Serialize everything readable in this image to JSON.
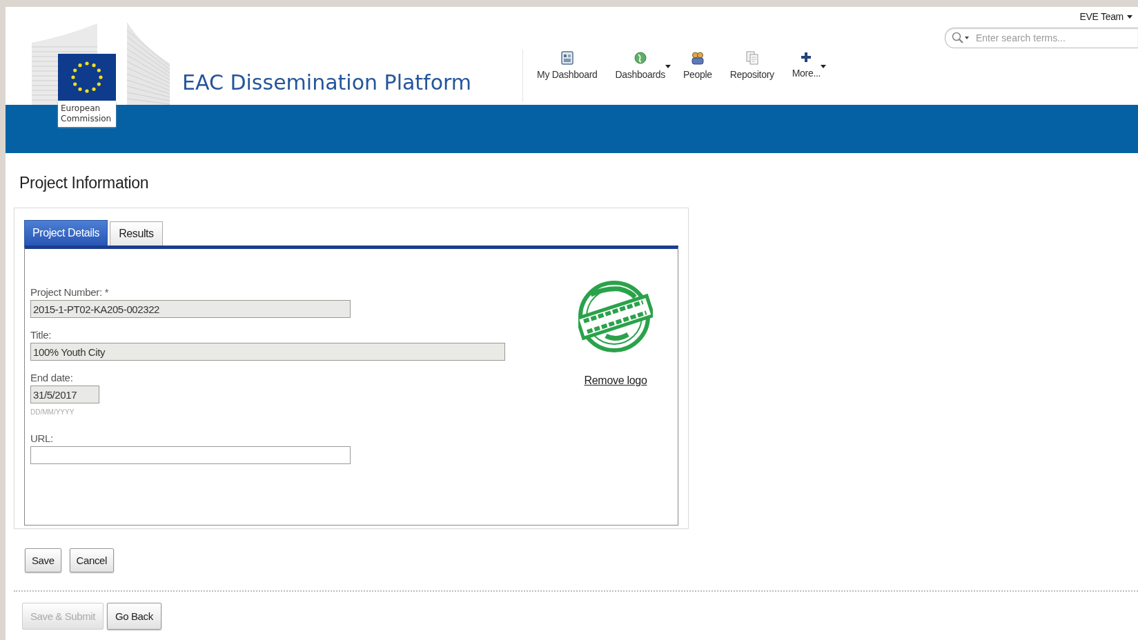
{
  "header": {
    "logo_caption": "European Commission",
    "site_title": "EAC Dissemination Platform",
    "user_menu": "EVE Team",
    "search": {
      "placeholder": "Enter search terms..."
    },
    "nav": [
      {
        "label": "My Dashboard",
        "kind": "dashboard",
        "dropdown": false
      },
      {
        "label": "Dashboards",
        "kind": "globe",
        "dropdown": true
      },
      {
        "label": "People",
        "kind": "people",
        "dropdown": false
      },
      {
        "label": "Repository",
        "kind": "repository",
        "dropdown": false
      },
      {
        "label": "More...",
        "kind": "plus",
        "dropdown": true
      }
    ]
  },
  "page_title": "Project Information",
  "tabs": [
    {
      "label": "Project Details",
      "selected": true
    },
    {
      "label": "Results",
      "selected": false
    }
  ],
  "fields": [
    {
      "label": "Project Number: *",
      "value": "2015-1-PT02-KA205-002322",
      "readonly": true
    },
    {
      "label": "Title:",
      "value": "100% Youth City",
      "readonly": true
    },
    {
      "label": "End date:",
      "value": "31/5/2017",
      "readonly": true,
      "hint": "DD/MM/YYYY"
    },
    {
      "label": "URL:",
      "readonly": false
    }
  ],
  "logo_link": "Remove logo",
  "form_buttons": [
    {
      "label": "Save",
      "disabled": false
    },
    {
      "label": "Cancel",
      "disabled": false
    }
  ],
  "footer_buttons": [
    {
      "label": "Save & Submit",
      "disabled": true
    },
    {
      "label": "Go Back",
      "disabled": false
    }
  ]
}
